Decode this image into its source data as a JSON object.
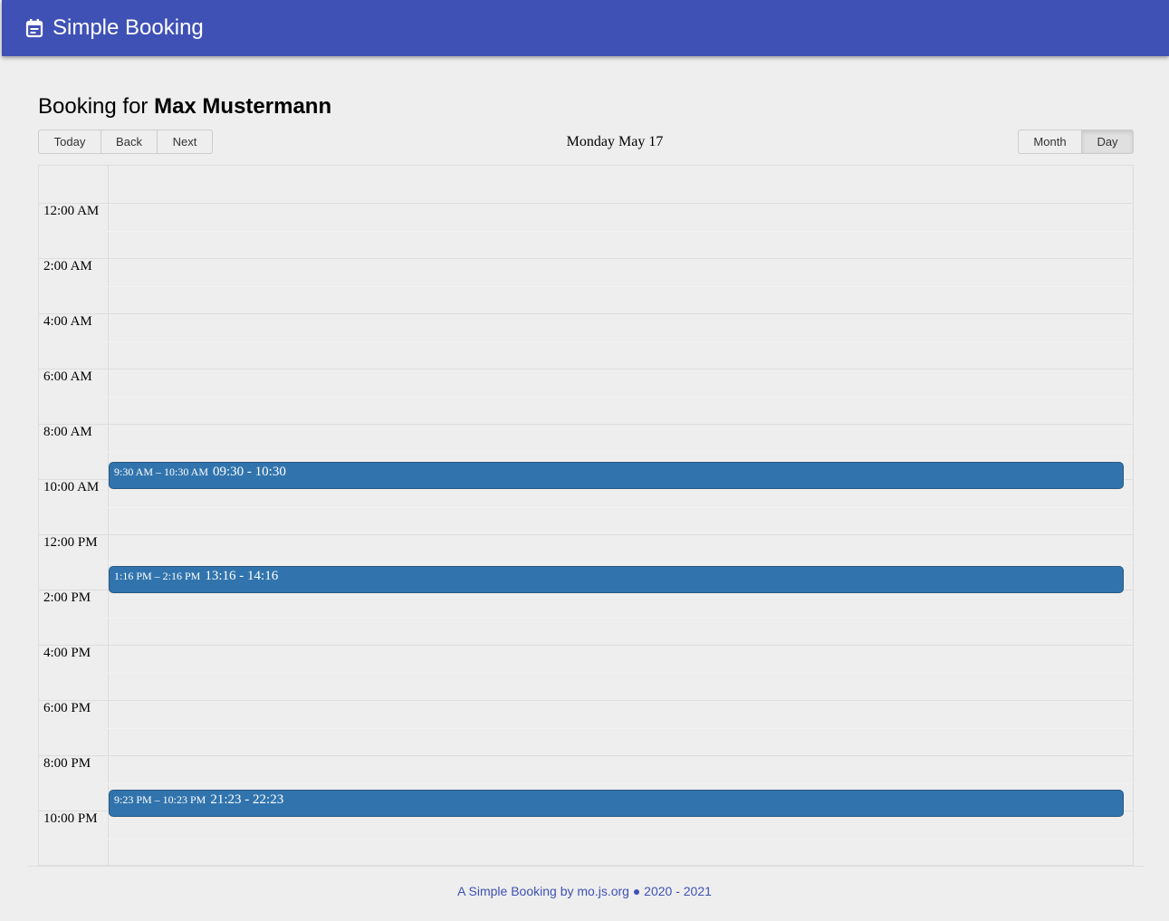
{
  "app": {
    "title": "Simple Booking",
    "icon": "calendar-icon"
  },
  "page": {
    "heading_prefix": "Booking for",
    "user_name": "Max Mustermann"
  },
  "toolbar": {
    "today_label": "Today",
    "back_label": "Back",
    "next_label": "Next",
    "date_label": "Monday May 17",
    "views": [
      {
        "label": "Month",
        "active": false
      },
      {
        "label": "Day",
        "active": true
      }
    ]
  },
  "time_labels": [
    "12:00 AM",
    "2:00 AM",
    "4:00 AM",
    "6:00 AM",
    "8:00 AM",
    "10:00 AM",
    "12:00 PM",
    "2:00 PM",
    "4:00 PM",
    "6:00 PM",
    "8:00 PM",
    "10:00 PM"
  ],
  "events": [
    {
      "time": "9:30 AM – 10:30 AM",
      "title": "09:30 - 10:30",
      "start_hour": 9.5
    },
    {
      "time": "1:16 PM – 2:16 PM",
      "title": "13:16 - 14:16",
      "start_hour": 13.267
    },
    {
      "time": "9:23 PM – 10:23 PM",
      "title": "21:23 - 22:23",
      "start_hour": 21.383
    }
  ],
  "footer": {
    "text": "A Simple Booking by mo.js.org ● 2020 - 2021"
  },
  "colors": {
    "primary": "#3f51b5",
    "event": "#3174ad",
    "background": "#eeeeee"
  }
}
